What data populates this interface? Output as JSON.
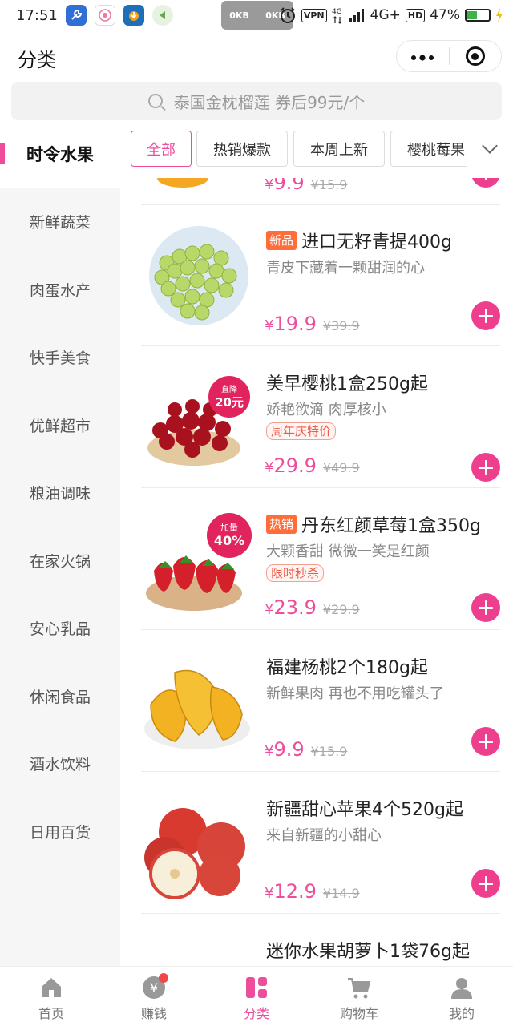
{
  "status_bar": {
    "time": "17:51",
    "speed_left": "0KB",
    "speed_right": "0KB",
    "vpn": "VPN",
    "network": "4G+",
    "hd": "HD",
    "battery": "47%",
    "battery_level": 0.47
  },
  "header": {
    "title": "分类"
  },
  "search": {
    "placeholder": "泰国金枕榴莲 券后99元/个"
  },
  "sidebar": {
    "items": [
      {
        "label": "时令水果"
      },
      {
        "label": "新鲜蔬菜"
      },
      {
        "label": "肉蛋水产"
      },
      {
        "label": "快手美食"
      },
      {
        "label": "优鲜超市"
      },
      {
        "label": "粮油调味"
      },
      {
        "label": "在家火锅"
      },
      {
        "label": "安心乳品"
      },
      {
        "label": "休闲食品"
      },
      {
        "label": "酒水饮料"
      },
      {
        "label": "日用百货"
      }
    ]
  },
  "filters": {
    "tabs": [
      {
        "label": "全部"
      },
      {
        "label": "热销爆款"
      },
      {
        "label": "本周上新"
      },
      {
        "label": "樱桃莓果"
      }
    ]
  },
  "products": [
    {
      "name": "",
      "tag": "",
      "desc": "",
      "badge": "",
      "price": "9.9",
      "original": "¥15.9",
      "img_label": ""
    },
    {
      "name": "进口无籽青提400g",
      "tag": "新品",
      "desc": "青皮下藏着一颗甜润的心",
      "badge": "",
      "price": "19.9",
      "original": "¥39.9",
      "img_label": ""
    },
    {
      "name": "美早樱桃1盒250g起",
      "tag": "",
      "desc": "娇艳欲滴 肉厚核小",
      "badge": "周年庆特价",
      "price": "29.9",
      "original": "¥49.9",
      "img_label": "直降 20元"
    },
    {
      "name": "丹东红颜草莓1盒350g",
      "tag": "热销",
      "desc": "大颗香甜 微微一笑是红颜",
      "badge": "限时秒杀",
      "price": "23.9",
      "original": "¥29.9",
      "img_label": "加量 40%"
    },
    {
      "name": "福建杨桃2个180g起",
      "tag": "",
      "desc": "新鲜果肉 再也不用吃罐头了",
      "badge": "",
      "price": "9.9",
      "original": "¥15.9",
      "img_label": ""
    },
    {
      "name": "新疆甜心苹果4个520g起",
      "tag": "",
      "desc": "来自新疆的小甜心",
      "badge": "",
      "price": "12.9",
      "original": "¥14.9",
      "img_label": ""
    },
    {
      "name": "迷你水果胡萝卜1袋76g起",
      "tag": "",
      "desc": "",
      "badge": "",
      "price": "",
      "original": "",
      "img_label": ""
    }
  ],
  "currency": "¥",
  "tabbar": {
    "items": [
      {
        "label": "首页"
      },
      {
        "label": "赚钱"
      },
      {
        "label": "分类"
      },
      {
        "label": "购物车"
      },
      {
        "label": "我的"
      }
    ]
  },
  "colors": {
    "accent": "#ee4d9b",
    "add_button": "#ee3f8e",
    "tag": "#ff6d3a"
  }
}
